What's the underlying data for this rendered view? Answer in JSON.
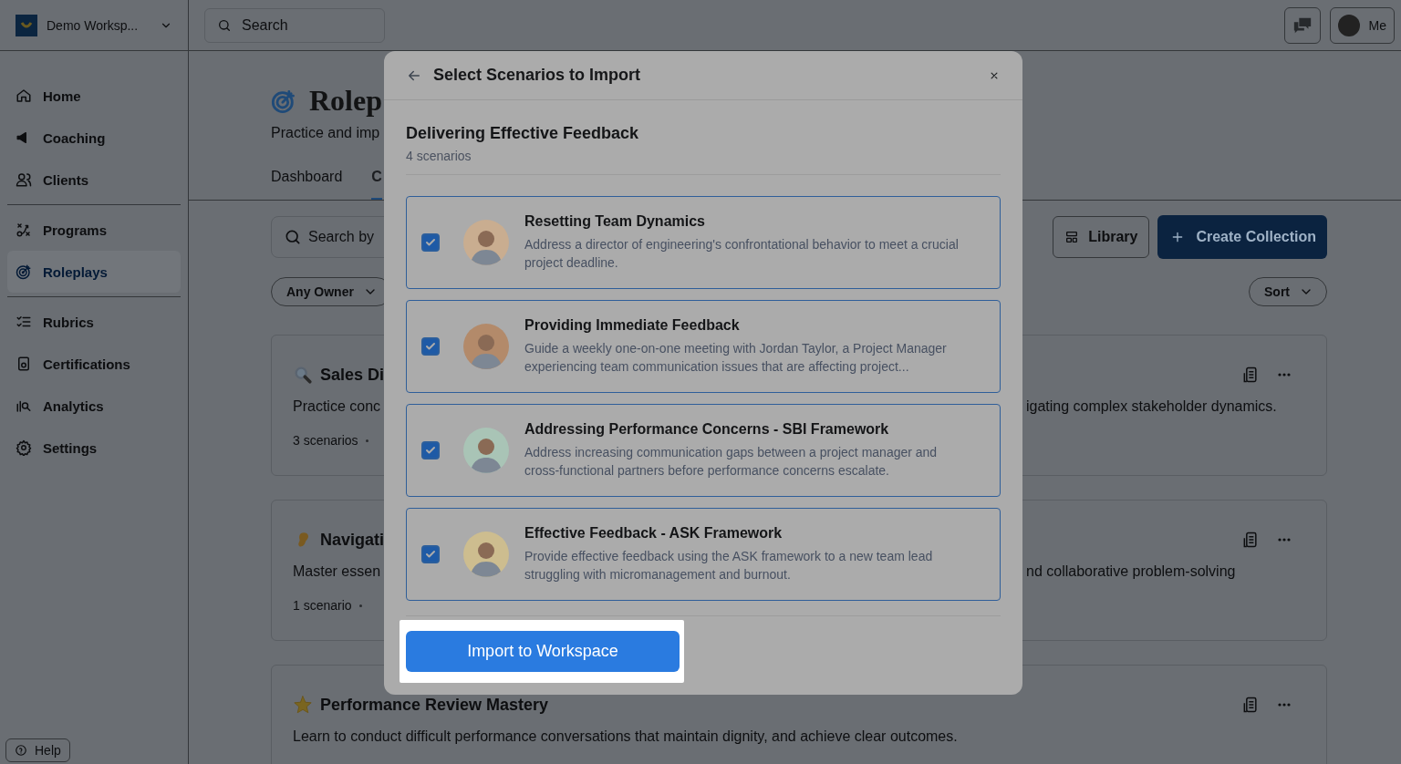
{
  "topbar": {
    "workspace": "Demo Worksp...",
    "search": {
      "placeholder": "Search"
    },
    "profile_label": "Me"
  },
  "sidebar": {
    "groups": [
      [
        {
          "label": "Home",
          "selected": false
        },
        {
          "label": "Coaching",
          "selected": false
        },
        {
          "label": "Clients",
          "selected": false
        }
      ],
      [
        {
          "label": "Programs",
          "selected": false
        },
        {
          "label": "Roleplays",
          "selected": true
        }
      ],
      [
        {
          "label": "Rubrics",
          "selected": false
        },
        {
          "label": "Certifications",
          "selected": false
        },
        {
          "label": "Analytics",
          "selected": false
        },
        {
          "label": "Settings",
          "selected": false
        }
      ]
    ],
    "help": "Help"
  },
  "page": {
    "title": "Rolep",
    "subtitle": "Practice and imp",
    "tabs": [
      {
        "label": "Dashboard",
        "selected": false
      },
      {
        "label": "C",
        "selected": true
      }
    ],
    "search": {
      "placeholder": "Search by"
    },
    "library_button": "Library",
    "create_button": "Create Collection",
    "owner_filter": "Any Owner",
    "sort": "Sort",
    "collections": [
      {
        "title": "Sales Di",
        "description_left": "Practice conc",
        "description_right": "igating complex stakeholder dynamics.",
        "meta": "3 scenarios"
      },
      {
        "title": "Navigati",
        "description_left": "Master essen",
        "description_right": "nd collaborative problem-solving",
        "meta": "1 scenario"
      },
      {
        "title": "Performance Review Mastery",
        "description_left": "Learn to conduct difficult performance conversations that maintain dignity, and achieve clear outcomes."
      }
    ]
  },
  "modal": {
    "title": "Select Scenarios to Import",
    "collection_title": "Delivering Effective Feedback",
    "count": "4 scenarios",
    "scenarios": [
      {
        "title": "Resetting Team Dynamics",
        "description": "Address a director of engineering's confrontational behavior to meet a crucial project deadline.",
        "checked": true
      },
      {
        "title": "Providing Immediate Feedback",
        "description": "Guide a weekly one-on-one meeting with Jordan Taylor, a Project Manager experiencing team communication issues that are affecting project...",
        "checked": true
      },
      {
        "title": "Addressing Performance Concerns - SBI Framework",
        "description": "Address increasing communication gaps between a project manager and cross-functional partners before performance concerns escalate.",
        "checked": true
      },
      {
        "title": "Effective Feedback - ASK Framework",
        "description": "Provide effective feedback using the ASK framework to a new team lead struggling with micromanagement and burnout.",
        "checked": true
      }
    ],
    "import_button": "Import to Workspace"
  }
}
